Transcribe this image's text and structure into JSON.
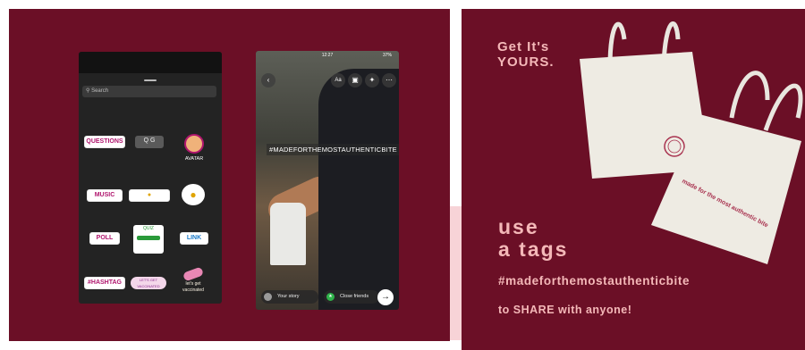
{
  "left": {
    "sticker_tray": {
      "search_placeholder": "Search",
      "stickers": {
        "questions": "QUESTIONS",
        "gif": "Q G",
        "avatar": "AVATAR",
        "music": "MUSIC",
        "poll": "POLL",
        "quiz": "QUIZ",
        "link": "LINK",
        "hashtag": "#HASHTAG",
        "eat_sticker": "LET'S GET VACCINATED",
        "vacc_sticker": "let's get vaccinated"
      }
    },
    "story": {
      "status_time": "12:27",
      "status_right": "37%",
      "text_tool": "Aa",
      "hashtag": "#MADEFORTHEMOSTAUTHENTICBITE",
      "your_story": "Your story",
      "close_friends": "Close friends"
    }
  },
  "right": {
    "headline_line1": "Get It's",
    "headline_line2": "YOURS.",
    "use_line1": "use",
    "use_line2": "a tags",
    "hashtag": "#madeforthemostauthenticbite",
    "share": "to SHARE with anyone!",
    "bag_print": "made for the most authentic bite"
  },
  "colors": {
    "background": "#6b0f26",
    "accent_text": "#f4b8b8"
  }
}
